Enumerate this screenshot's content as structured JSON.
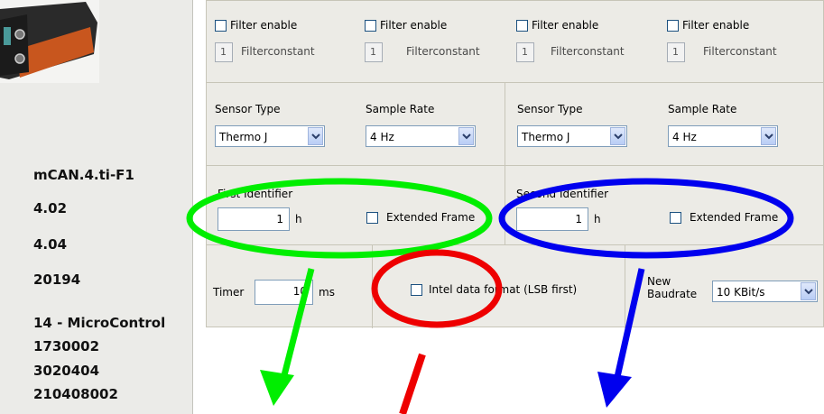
{
  "device": {
    "name": "mCAN.4.ti-F1",
    "hw_version": "4.02",
    "sw_version": "4.04",
    "serial": "20194",
    "vendor": "14 - MicroControl",
    "product_code": "1730002",
    "revision": "3020404",
    "extra_id": "210408002"
  },
  "filters": [
    {
      "enable_label": "Filter enable",
      "value": "1",
      "const_label": "Filterconstant"
    },
    {
      "enable_label": "Filter enable",
      "value": "1",
      "const_label": "Filterconstant"
    },
    {
      "enable_label": "Filter enable",
      "value": "1",
      "const_label": "Filterconstant"
    },
    {
      "enable_label": "Filter enable",
      "value": "1",
      "const_label": "Filterconstant"
    }
  ],
  "sensors": [
    {
      "type_label": "Sensor Type",
      "type_value": "Thermo J",
      "rate_label": "Sample Rate",
      "rate_value": "4 Hz"
    },
    {
      "type_label": "Sensor Type",
      "type_value": "Thermo J",
      "rate_label": "Sample Rate",
      "rate_value": "4 Hz"
    }
  ],
  "identifiers": [
    {
      "label": "First Identifier",
      "value": "1",
      "unit": "h",
      "ext_label": "Extended Frame"
    },
    {
      "label": "Second Identifier",
      "value": "1",
      "unit": "h",
      "ext_label": "Extended Frame"
    }
  ],
  "timer": {
    "label": "Timer",
    "value": "10",
    "unit": "ms"
  },
  "intel": {
    "label": "Intel data format (LSB first)"
  },
  "baud": {
    "label_line1": "New",
    "label_line2": "Baudrate",
    "value": "10 KBit/s"
  },
  "annotations": {
    "colors": [
      "#00ee00",
      "#0000ee",
      "#ee0000"
    ]
  }
}
